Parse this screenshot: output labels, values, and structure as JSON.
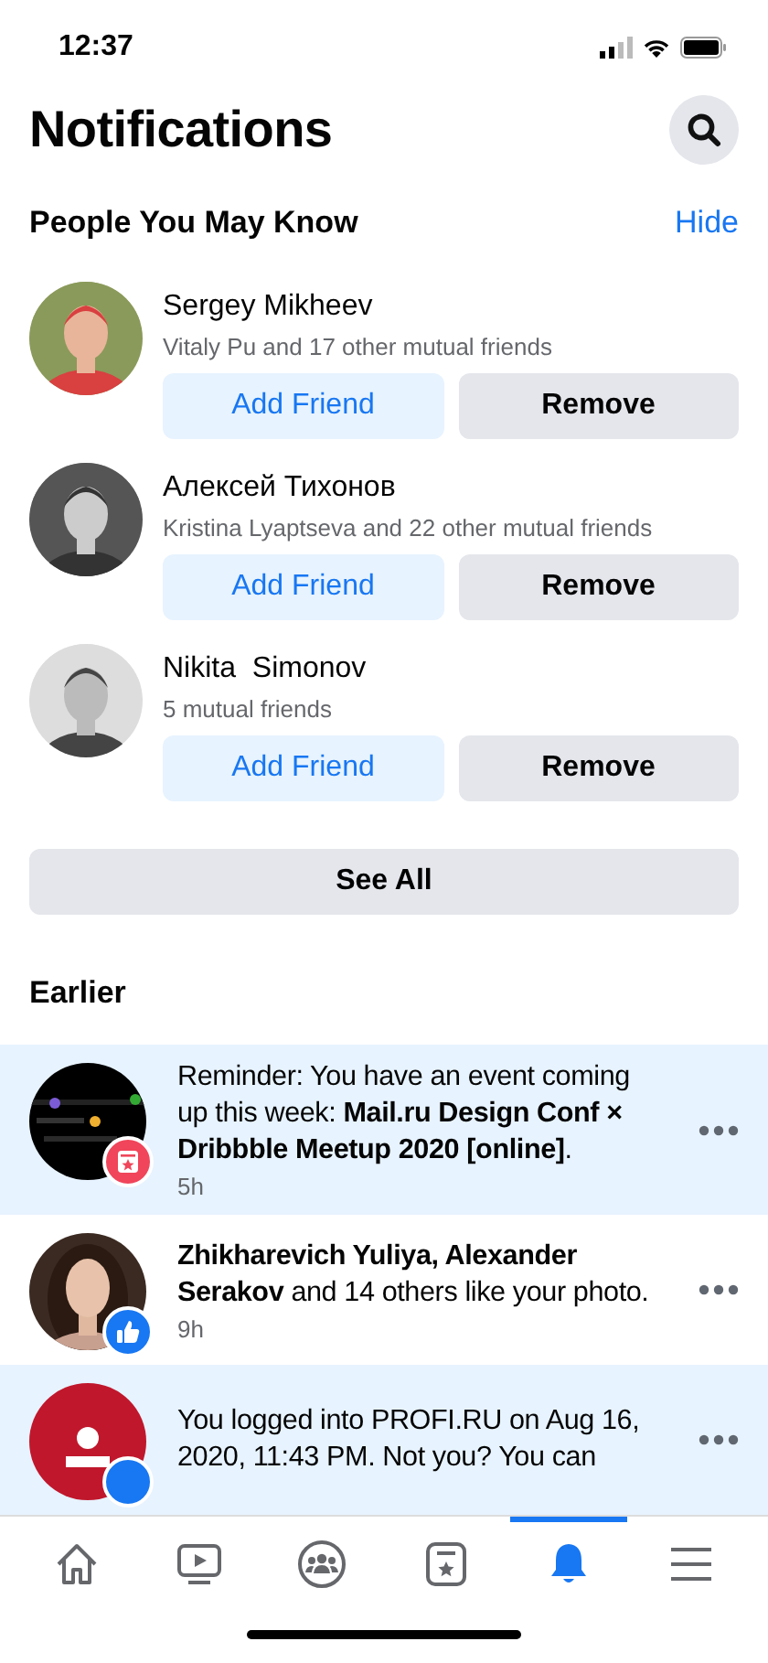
{
  "status_bar": {
    "time": "12:37"
  },
  "header": {
    "title": "Notifications"
  },
  "people_section": {
    "title": "People You May Know",
    "hide_link": "Hide",
    "see_all": "See All",
    "people": [
      {
        "name": "Sergey Mikheev",
        "mutual": "Vitaly Pu and 17 other mutual friends",
        "add": "Add Friend",
        "remove": "Remove"
      },
      {
        "name": "Алексей Тихонов",
        "mutual": "Kristina Lyaptseva and 22 other mutual friends",
        "add": "Add Friend",
        "remove": "Remove"
      },
      {
        "name": "Nikita  Simonov",
        "mutual": "5 mutual friends",
        "add": "Add Friend",
        "remove": "Remove"
      }
    ]
  },
  "earlier_section": {
    "title": "Earlier",
    "notifications": [
      {
        "text": "Reminder: You have an event coming up this week: **Mail.ru Design Conf × Dribbble Meetup 2020 [online]**.",
        "time": "5h",
        "unread": true,
        "kind": "event",
        "badge": {
          "kind": "event"
        }
      },
      {
        "text": "**Zhikharevich Yuliya, Alexander Serakov** and 14 others like your photo.",
        "time": "9h",
        "unread": false,
        "badge": {
          "kind": "like"
        }
      },
      {
        "text": "You logged into PROFI.RU on Aug 16, 2020, 11:43 PM. Not you? You can",
        "unread": true,
        "kind": "login",
        "badge": {
          "kind": "login"
        }
      }
    ]
  },
  "tab_bar": [
    {
      "kind": "home",
      "selected": false
    },
    {
      "kind": "video",
      "selected": false
    },
    {
      "kind": "groups",
      "selected": false
    },
    {
      "kind": "events",
      "selected": false
    },
    {
      "kind": "notifications",
      "selected": true
    },
    {
      "kind": "menu",
      "selected": false
    }
  ]
}
